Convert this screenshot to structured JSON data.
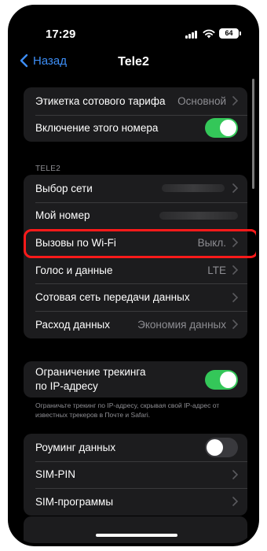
{
  "status_bar": {
    "time": "17:29",
    "battery": "64"
  },
  "nav": {
    "back_label": "Назад",
    "title": "Tele2"
  },
  "group1": [
    {
      "label": "Этикетка сотового тарифа",
      "value": "Основной"
    },
    {
      "label": "Включение этого номера",
      "toggle": true
    }
  ],
  "section_tele2": {
    "header": "TELE2"
  },
  "group2": [
    {
      "label": "Выбор сети",
      "value": ""
    },
    {
      "label": "Мой номер",
      "value": ""
    },
    {
      "label": "Вызовы по Wi-Fi",
      "value": "Выкл."
    },
    {
      "label": "Голос и данные",
      "value": "LTE"
    },
    {
      "label": "Сотовая сеть передачи данных",
      "value": ""
    },
    {
      "label": "Расход данных",
      "value": "Экономия данных"
    }
  ],
  "group3": [
    {
      "label": "Ограничение трекинга\nпо IP-адресу",
      "toggle": true
    }
  ],
  "footnote": "Ограничьте трекинг по IP-адресу, скрывая свой IP-адрес от известных трекеров в Почте и Safari.",
  "group4": [
    {
      "label": "Роуминг данных",
      "toggle": false
    },
    {
      "label": "SIM-PIN"
    },
    {
      "label": "SIM-программы"
    }
  ],
  "colors": {
    "accent": "#3d8ef6",
    "toggle_on": "#34c759",
    "highlight": "#ff1a1a",
    "cell_bg": "#1c1c1e"
  }
}
